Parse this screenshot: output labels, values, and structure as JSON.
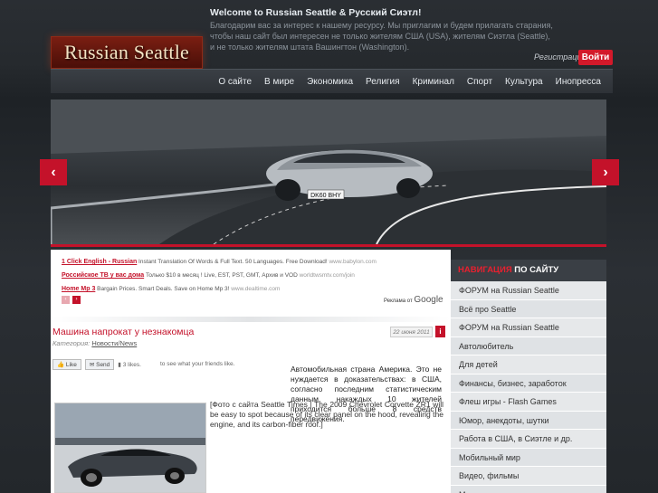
{
  "header": {
    "welcome_title": "Welcome to Russian Seattle & Русский Сиэтл!",
    "welcome_text": "Благодарим вас за интерес к нашему ресурсу. Мы приглагим и будем прилагать старания, чтобы наш сайт был интересен не только жителям США (USA), жителям Сиэтла (Seattle), и не только жителям штата Вашингтон (Washington).",
    "logo_text": "Russian Seattle",
    "register_label": "Регистрация",
    "login_label": "Войти"
  },
  "nav": {
    "items": [
      {
        "label": "О сайте"
      },
      {
        "label": "В мире"
      },
      {
        "label": "Экономика"
      },
      {
        "label": "Религия"
      },
      {
        "label": "Криминал"
      },
      {
        "label": "Спорт"
      },
      {
        "label": "Культура"
      },
      {
        "label": "Инопресса"
      }
    ]
  },
  "slider": {
    "prev_label": "‹",
    "next_label": "›",
    "plate_text": "DK60 BHY"
  },
  "ads": {
    "rows": [
      {
        "title": "1 Click English - Russian",
        "text": " Instant Translation Of Words & Full Text. 50 Languages. Free Download! ",
        "url": "www.babylon.com"
      },
      {
        "title": "Российское ТВ у вас дома",
        "text": " Только $10 в месяц ! Live, EST, PST, GMT, Архив и VOD ",
        "url": "worldtwsmtv.com/join"
      },
      {
        "title": "Home Mp 3",
        "text": " Bargain Prices. Smart Deals. Save on Home Mp 3! ",
        "url": "www.dealtime.com"
      }
    ],
    "prev_label": "‹",
    "next_label": "›",
    "ads_by": "Реклама от",
    "google": "Google"
  },
  "article": {
    "title": "Машина напрокат у незнакомца",
    "category_label": "Категория:",
    "category_link": "Новости/News",
    "date": "22 июня 2011",
    "info_icon": "i",
    "like_label": "Like",
    "send_label": "Send",
    "likes_count": "3 likes.",
    "see_friends": "to see what your friends like.",
    "lead": "Автомобильная страна   Америка.      Это не нуждается в доказательствах: в США, согласно последним статистическим данным, накаждых 10 жителей приходится больше 8 средств передвижения.",
    "caption": "[Фото с сайта Seattle Times | The 2009 Chevrolet Corvette ZR1 will be easy to spot because of its clear panel on the hood, revealing the engine, and its carbon-fiber roof.]"
  },
  "sidebar": {
    "heading_accent": "НАВИГАЦИЯ",
    "heading_rest": " ПО САЙТУ",
    "items": [
      {
        "label": "ФОРУМ на Russian Seattle"
      },
      {
        "label": "Всё про Seattle"
      },
      {
        "label": "ФОРУМ на Russian Seattle"
      },
      {
        "label": "Автолюбитель"
      },
      {
        "label": "Для детей"
      },
      {
        "label": "Финансы, бизнес, заработок"
      },
      {
        "label": "Флеш игры - Flash Games"
      },
      {
        "label": "Юмор, анекдоты, шутки"
      },
      {
        "label": "Работа в США, в Сиэтле и др."
      },
      {
        "label": "Мобильный мир"
      },
      {
        "label": "Видео, фильмы"
      },
      {
        "label": "Музыка"
      }
    ]
  },
  "colors": {
    "accent": "#c4122a",
    "nav_bg": "#3a3f45",
    "page_bg": "#1f2328"
  }
}
